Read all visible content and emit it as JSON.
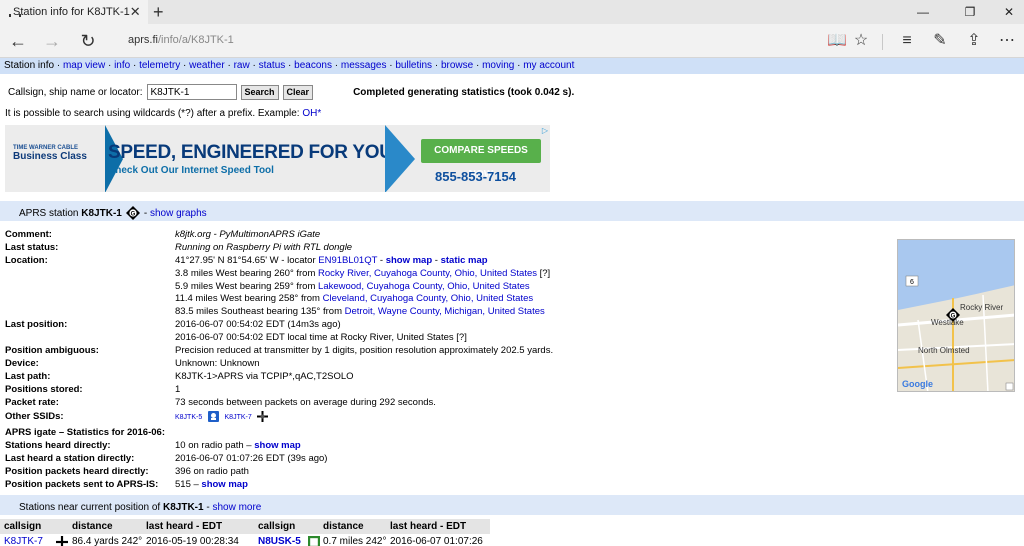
{
  "browser": {
    "tab_title": "Station info for K8JTK-1",
    "tab_close": "✕",
    "new_tab": "+",
    "url_host": "aprs.fi",
    "url_path": "/info/a/K8JTK-1",
    "win_min": "—",
    "win_restore": "❐",
    "win_close": "✕"
  },
  "menu": [
    {
      "label": "Station info",
      "link": false
    },
    {
      "label": "map view",
      "link": true
    },
    {
      "label": "info",
      "link": true
    },
    {
      "label": "telemetry",
      "link": true
    },
    {
      "label": "weather",
      "link": true
    },
    {
      "label": "raw",
      "link": true
    },
    {
      "label": "status",
      "link": true
    },
    {
      "label": "beacons",
      "link": true
    },
    {
      "label": "messages",
      "link": true
    },
    {
      "label": "bulletins",
      "link": true
    },
    {
      "label": "browse",
      "link": true
    },
    {
      "label": "moving",
      "link": true
    },
    {
      "label": "my account",
      "link": true
    }
  ],
  "search": {
    "label": "Callsign, ship name or locator:",
    "value": "K8JTK-1",
    "search_button": "Search",
    "clear_button": "Clear",
    "status": "Completed generating statistics (took 0.042 s)."
  },
  "wildcard": {
    "text": "It is possible to search using wildcards (*?) after a prefix. Example:",
    "example": "OH*"
  },
  "ad": {
    "brand_small": "TIME WARNER CABLE",
    "brand": "Business Class",
    "headline_a": "SPEED,",
    "headline_b": " ENGINEERED FOR YOU",
    "subline": "Check Out Our Internet Speed Tool",
    "cta": "COMPARE SPEEDS NOW",
    "phone": "855-853-7154",
    "adchoice": "▷"
  },
  "station": {
    "header_prefix": "APRS station",
    "callsign": "K8JTK-1",
    "symbol_letter": "G",
    "graphs_link": "show graphs"
  },
  "info": {
    "comment_label": "Comment:",
    "comment": "k8jtk.org - PyMultimonAPRS iGate",
    "last_status_label": "Last status:",
    "last_status": "Running on Raspberry Pi with RTL dongle",
    "location_label": "Location:",
    "location_text": "41°27.95' N 81°54.65' W - locator",
    "locator": "EN91BL01QT",
    "show_map": "show map",
    "static_map": "static map",
    "nearby": [
      {
        "text": "3.8 miles West bearing 260° from",
        "place": "Rocky River, Cuyahoga County, Ohio, United States",
        "extra": " [?]"
      },
      {
        "text": "5.9 miles West bearing 259° from",
        "place": "Lakewood, Cuyahoga County, Ohio, United States",
        "extra": ""
      },
      {
        "text": "11.4 miles West bearing 258° from",
        "place": "Cleveland, Cuyahoga County, Ohio, United States",
        "extra": ""
      },
      {
        "text": "83.5 miles Southeast bearing 135° from",
        "place": "Detroit, Wayne County, Michigan, United States",
        "extra": ""
      }
    ],
    "last_position_label": "Last position:",
    "last_position": "2016-06-07 00:54:02 EDT (14m3s ago)",
    "local_time": "2016-06-07 00:54:02 EDT local time at Rocky River, United States [?]",
    "ambiguous_label": "Position ambiguous:",
    "ambiguous": "Precision reduced at transmitter by 1 digits, position resolution approximately 202.5 yards.",
    "device_label": "Device:",
    "device": "Unknown: Unknown",
    "last_path_label": "Last path:",
    "last_path": "K8JTK-1>APRS via TCPIP*,qAC,T2SOLO",
    "positions_label": "Positions stored:",
    "positions": "1",
    "packet_rate_label": "Packet rate:",
    "packet_rate": "73 seconds between packets on average during 292 seconds.",
    "other_ssids_label": "Other SSIDs:",
    "ssid1": "K8JTK-5",
    "ssid2": "K8JTK-7"
  },
  "igate": {
    "title": "APRS igate – Statistics for 2016-06:",
    "heard_directly_label": "Stations heard directly:",
    "heard_directly": "10 on radio path –",
    "heard_map": "show map",
    "last_heard_label": "Last heard a station directly:",
    "last_heard": "2016-06-07 01:07:26 EDT (39s ago)",
    "pos_heard_label": "Position packets heard directly:",
    "pos_heard": "396 on radio path",
    "pos_sent_label": "Position packets sent to APRS-IS:",
    "pos_sent": "515 –",
    "sent_map": "show map"
  },
  "map": {
    "city1": "Rocky River",
    "city2": "Westlake",
    "city3": "North Olmsted",
    "route": "6",
    "marker": "G",
    "google": "Google"
  },
  "stations_near": {
    "prefix": "Stations near current position of",
    "callsign": "K8JTK-1",
    "more": "show more",
    "col_callsign": "callsign",
    "col_distance": "distance",
    "col_last_heard": "last heard - EDT",
    "row": {
      "call1": "K8JTK-7",
      "dist1": "86.4 yards 242°",
      "time1": "2016-05-19 00:28:34",
      "call2": "N8USK-5",
      "dist2": "0.7 miles 242°",
      "time2": "2016-06-07 01:07:26"
    }
  },
  "colors": {
    "link": "#0000cc",
    "menu_bg": "#cfe0f7",
    "section_bg": "#dde8f8",
    "cta_green": "#58b04b"
  }
}
